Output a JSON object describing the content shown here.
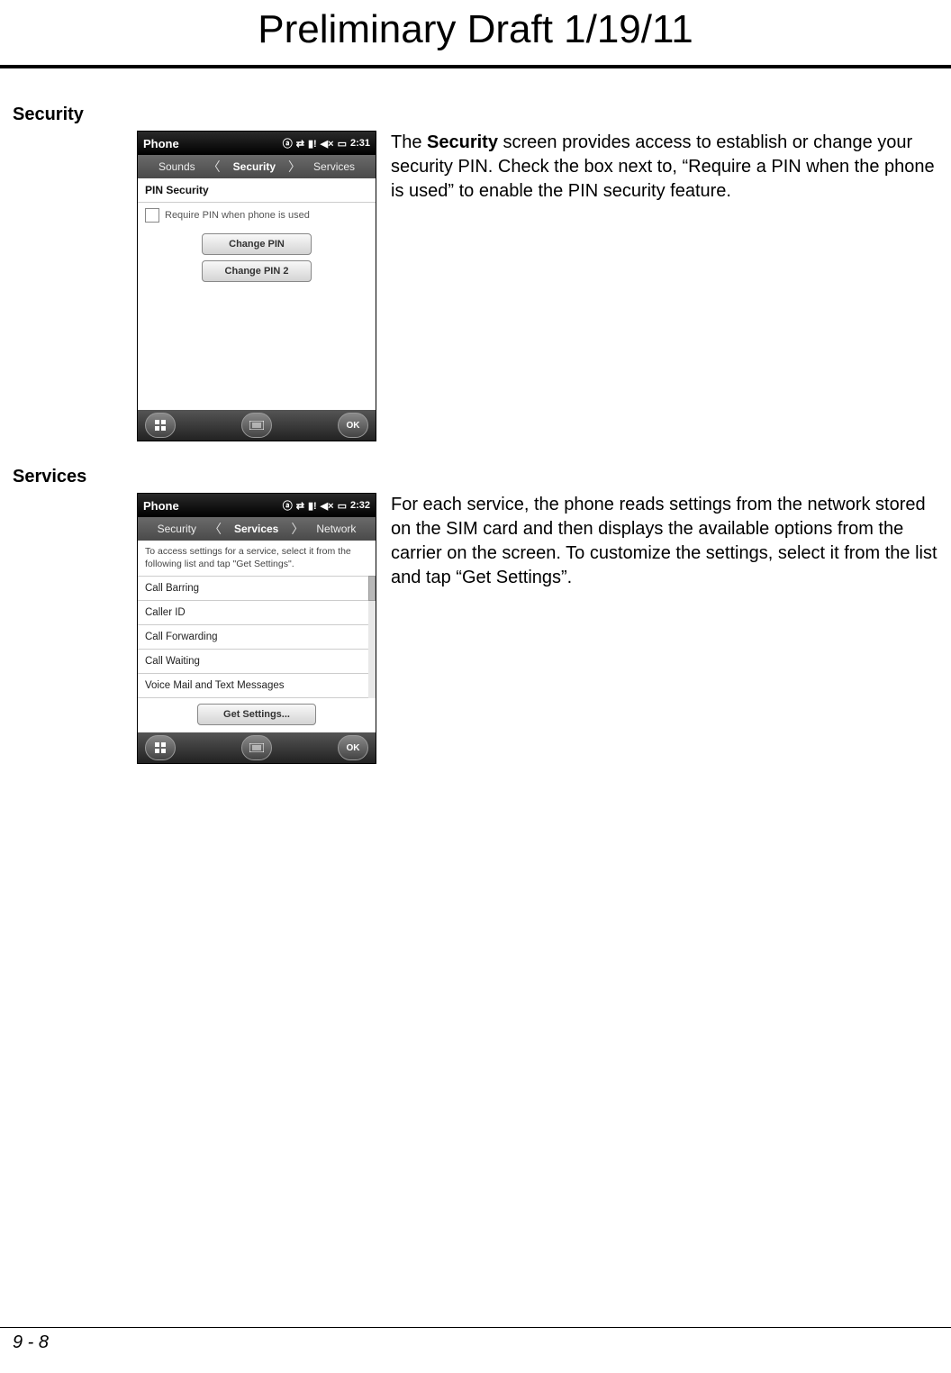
{
  "draft_header": "Preliminary Draft 1/19/11",
  "page_number": "9 - 8",
  "sections": {
    "security": {
      "heading": "Security",
      "description_prefix": "The ",
      "description_bold": "Security",
      "description_suffix": " screen provides access to establish or change your security PIN. Check the box next to, “Require a PIN when the phone is used” to enable the PIN security feature.",
      "screenshot": {
        "titlebar": {
          "title": "Phone",
          "time": "2:31"
        },
        "tabs": {
          "left": "Sounds",
          "active": "Security",
          "right": "Services"
        },
        "section_label": "PIN Security",
        "checkbox_label": "Require PIN when phone is used",
        "buttons": {
          "change_pin": "Change PIN",
          "change_pin2": "Change PIN 2"
        },
        "softkeys": {
          "ok": "OK"
        }
      }
    },
    "services": {
      "heading": "Services",
      "description": "For each service, the phone reads settings from the network stored on the SIM card and then displays the available options from the carrier on the screen. To customize the settings, select it from the list and tap “Get Settings”.",
      "screenshot": {
        "titlebar": {
          "title": "Phone",
          "time": "2:32"
        },
        "tabs": {
          "left": "Security",
          "active": "Services",
          "right": "Network"
        },
        "instruction": "To access settings for a service, select it from the following list and tap \"Get Settings\".",
        "items": [
          "Call Barring",
          "Caller ID",
          "Call Forwarding",
          "Call Waiting",
          "Voice Mail and Text Messages"
        ],
        "get_settings_label": "Get Settings...",
        "softkeys": {
          "ok": "OK"
        }
      }
    }
  }
}
